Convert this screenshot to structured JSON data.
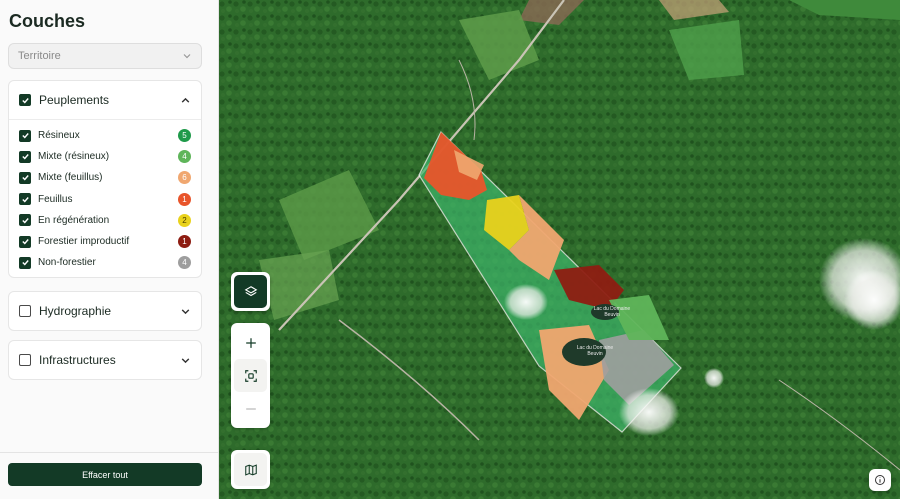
{
  "sidebar": {
    "title": "Couches",
    "territory_placeholder": "Territoire",
    "peuplements": {
      "label": "Peuplements",
      "checked": true,
      "expanded": true,
      "items": [
        {
          "label": "Résineux",
          "count": "5",
          "color": "#1f9a4a",
          "checked": true
        },
        {
          "label": "Mixte (résineux)",
          "count": "4",
          "color": "#5fb55a",
          "checked": true
        },
        {
          "label": "Mixte (feuillus)",
          "count": "6",
          "color": "#f0a770",
          "checked": true
        },
        {
          "label": "Feuillus",
          "count": "1",
          "color": "#e8552b",
          "checked": true
        },
        {
          "label": "En régénération",
          "count": "2",
          "color": "#e9d21c",
          "checked": true
        },
        {
          "label": "Forestier improductif",
          "count": "1",
          "color": "#8e1d12",
          "checked": true
        },
        {
          "label": "Non-forestier",
          "count": "4",
          "color": "#9e9e9e",
          "checked": true
        }
      ]
    },
    "hydrographie": {
      "label": "Hydrographie",
      "checked": false,
      "expanded": false
    },
    "infrastructures": {
      "label": "Infrastructures",
      "checked": false,
      "expanded": false
    },
    "clear_label": "Effacer tout"
  },
  "map": {
    "lakes": [
      {
        "label": "Lac du Domaine Beuvin"
      },
      {
        "label": "Lac du Domaine Beuvin"
      }
    ],
    "controls": {
      "layers": "layers-icon",
      "zoom_in": "plus-icon",
      "fit": "focus-icon",
      "zoom_out": "minus-icon",
      "basemap": "map-icon",
      "info": "info-icon"
    }
  },
  "colors": {
    "accent": "#133a26"
  }
}
